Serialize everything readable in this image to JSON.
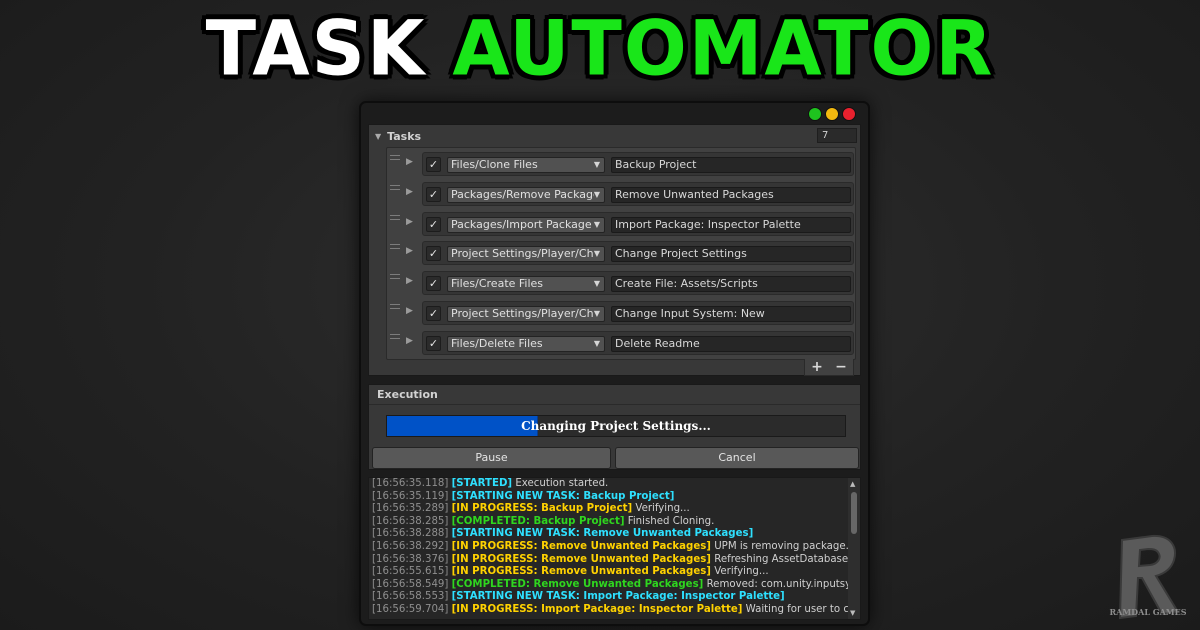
{
  "title": {
    "word1": "TASK",
    "word2": "AUTOMATOR"
  },
  "window_controls": {
    "colors": [
      "#1ec31e",
      "#f2b90f",
      "#e8212e"
    ]
  },
  "tasks": {
    "header": "Tasks",
    "count": "7",
    "items": [
      {
        "checked": true,
        "type": "Files/Clone Files",
        "name": "Backup Project"
      },
      {
        "checked": true,
        "type": "Packages/Remove Package",
        "name": "Remove Unwanted Packages"
      },
      {
        "checked": true,
        "type": "Packages/Import Package",
        "name": "Import Package: Inspector Palette"
      },
      {
        "checked": true,
        "type": "Project Settings/Player/Chan",
        "name": "Change Project Settings"
      },
      {
        "checked": true,
        "type": "Files/Create Files",
        "name": "Create File: Assets/Scripts"
      },
      {
        "checked": true,
        "type": "Project Settings/Player/Chan",
        "name": "Change Input System: New"
      },
      {
        "checked": true,
        "type": "Files/Delete Files",
        "name": "Delete Readme"
      }
    ],
    "add_label": "+",
    "remove_label": "−"
  },
  "execution": {
    "header": "Execution",
    "progress_text": "Changing Project Settings...",
    "progress_fraction": 0.33,
    "progress_color": "#0052c7",
    "pause_label": "Pause",
    "cancel_label": "Cancel"
  },
  "console": {
    "lines": [
      {
        "ts": "[16:56:35.118]",
        "tag": "[STARTED]",
        "kind": "started",
        "msg": "Execution started."
      },
      {
        "ts": "[16:56:35.119]",
        "tag": "[STARTING NEW TASK: Backup Project]",
        "kind": "started",
        "msg": ""
      },
      {
        "ts": "[16:56:35.289]",
        "tag": "[IN PROGRESS: Backup Project]",
        "kind": "progress",
        "msg": "Verifying..."
      },
      {
        "ts": "[16:56:38.285]",
        "tag": "[COMPLETED: Backup Project]",
        "kind": "completed",
        "msg": "Finished Cloning."
      },
      {
        "ts": "[16:56:38.288]",
        "tag": "[STARTING NEW TASK: Remove Unwanted Packages]",
        "kind": "started",
        "msg": ""
      },
      {
        "ts": "[16:56:38.292]",
        "tag": "[IN PROGRESS: Remove Unwanted Packages]",
        "kind": "progress",
        "msg": "UPM is removing package..."
      },
      {
        "ts": "[16:56:38.376]",
        "tag": "[IN PROGRESS: Remove Unwanted Packages]",
        "kind": "progress",
        "msg": "Refreshing AssetDatabase..."
      },
      {
        "ts": "[16:56:55.615]",
        "tag": "[IN PROGRESS: Remove Unwanted Packages]",
        "kind": "progress",
        "msg": "Verifying..."
      },
      {
        "ts": "[16:56:58.549]",
        "tag": "[COMPLETED: Remove Unwanted Packages]",
        "kind": "completed",
        "msg": "Removed: com.unity.inputsystem"
      },
      {
        "ts": "[16:56:58.553]",
        "tag": "[STARTING NEW TASK: Import Package: Inspector Palette]",
        "kind": "started",
        "msg": ""
      },
      {
        "ts": "[16:56:59.704]",
        "tag": "[IN PROGRESS: Import Package: Inspector Palette]",
        "kind": "progress",
        "msg": "Waiting for user to confirm"
      }
    ]
  },
  "branding": {
    "logo_letter": "R",
    "logo_text": "RAMDAL GAMES"
  }
}
